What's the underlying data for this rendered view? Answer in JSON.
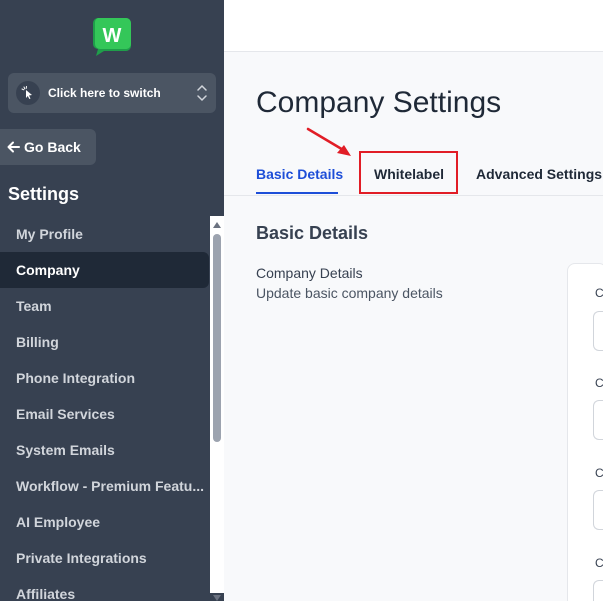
{
  "sidebar": {
    "switcher_label": "Click here to switch",
    "go_back_label": "Go Back",
    "settings_title": "Settings",
    "items": [
      {
        "label": "My Profile",
        "active": false
      },
      {
        "label": "Company",
        "active": true
      },
      {
        "label": "Team",
        "active": false
      },
      {
        "label": "Billing",
        "active": false
      },
      {
        "label": "Phone Integration",
        "active": false
      },
      {
        "label": "Email Services",
        "active": false
      },
      {
        "label": "System Emails",
        "active": false
      },
      {
        "label": "Workflow - Premium Featu...",
        "active": false
      },
      {
        "label": "AI Employee",
        "active": false
      },
      {
        "label": "Private Integrations",
        "active": false
      },
      {
        "label": "Affiliates",
        "active": false
      }
    ]
  },
  "main": {
    "page_title": "Company Settings",
    "tabs": [
      {
        "label": "Basic Details",
        "active": true
      },
      {
        "label": "Whitelabel",
        "active": false
      },
      {
        "label": "Advanced Settings",
        "active": false
      }
    ],
    "section_title": "Basic Details",
    "company_details_title": "Company Details",
    "company_details_sub": "Update basic company details",
    "field_labels": [
      "C",
      "C",
      "C",
      "C"
    ]
  },
  "colors": {
    "sidebar_bg": "#374151",
    "active_tab": "#1d4ed8",
    "highlight": "#e11d26",
    "logo_green": "#22c55e"
  },
  "icons": [
    "logo-icon",
    "cursor-click-icon",
    "chevron-updown-icon",
    "arrow-left-icon",
    "annotation-arrow-icon"
  ]
}
